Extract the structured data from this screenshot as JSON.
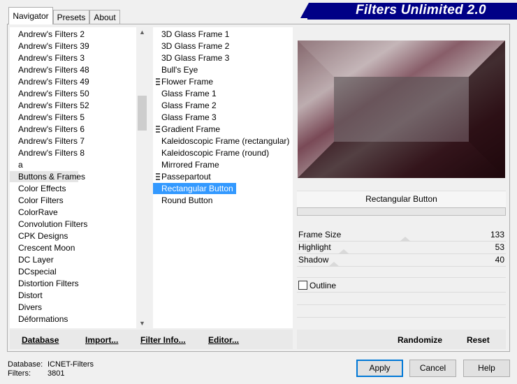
{
  "app": {
    "title": "Filters Unlimited 2.0"
  },
  "tabs": [
    {
      "label": "Navigator",
      "active": true
    },
    {
      "label": "Presets",
      "active": false
    },
    {
      "label": "About",
      "active": false
    }
  ],
  "categories": [
    "Andrew's Filters 2",
    "Andrew's Filters 39",
    "Andrew's Filters 3",
    "Andrew's Filters 48",
    "Andrew's Filters 49",
    "Andrew's Filters 50",
    "Andrew's Filters 52",
    "Andrew's Filters 5",
    "Andrew's Filters 6",
    "Andrew's Filters 7",
    "Andrew's Filters 8",
    "a",
    "Buttons & Frames",
    "Color Effects",
    "Color Filters",
    "ColorRave",
    "Convolution Filters",
    "CPK Designs",
    "Crescent Moon",
    "DC Layer",
    "DCspecial",
    "Distortion Filters",
    "Distort",
    "Divers",
    "Déformations"
  ],
  "selected_category": "Buttons & Frames",
  "filters": [
    {
      "label": "3D Glass Frame 1",
      "marker": false
    },
    {
      "label": "3D Glass Frame 2",
      "marker": false
    },
    {
      "label": "3D Glass Frame 3",
      "marker": false
    },
    {
      "label": "Bull's Eye",
      "marker": false
    },
    {
      "label": "Flower Frame",
      "marker": true
    },
    {
      "label": "Glass Frame 1",
      "marker": false
    },
    {
      "label": "Glass Frame 2",
      "marker": false
    },
    {
      "label": "Glass Frame 3",
      "marker": false
    },
    {
      "label": "Gradient Frame",
      "marker": true
    },
    {
      "label": "Kaleidoscopic Frame (rectangular)",
      "marker": false
    },
    {
      "label": "Kaleidoscopic Frame (round)",
      "marker": false
    },
    {
      "label": "Mirrored Frame",
      "marker": false
    },
    {
      "label": "Passepartout",
      "marker": true
    },
    {
      "label": "Rectangular Button",
      "marker": false
    },
    {
      "label": "Round Button",
      "marker": false
    }
  ],
  "selected_filter": "Rectangular Button",
  "panel_buttons": {
    "database": "Database",
    "import": "Import...",
    "filter_info": "Filter Info...",
    "editor": "Editor..."
  },
  "params": {
    "filter_name": "Rectangular Button",
    "sliders": [
      {
        "label": "Frame Size",
        "value": "133",
        "fraction": 0.52
      },
      {
        "label": "Highlight",
        "value": "53",
        "fraction": 0.21
      },
      {
        "label": "Shadow",
        "value": "40",
        "fraction": 0.16
      }
    ],
    "outline_label": "Outline",
    "outline_checked": false
  },
  "right_buttons": {
    "randomize": "Randomize",
    "reset": "Reset"
  },
  "footer": {
    "database_label": "Database:",
    "database_value": "ICNET-Filters",
    "filters_label": "Filters:",
    "filters_value": "3801"
  },
  "dialog_buttons": {
    "apply": "Apply",
    "cancel": "Cancel",
    "help": "Help"
  },
  "colors": {
    "accent": "#000086",
    "selection": "#3399ff",
    "focus": "#0078d7"
  }
}
